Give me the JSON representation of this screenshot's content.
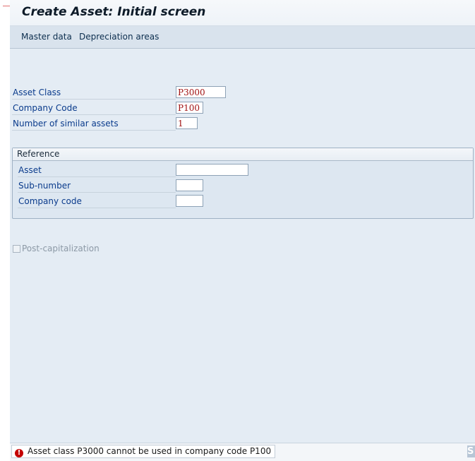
{
  "title": "Create Asset:  Initial screen",
  "toolbar": {
    "master_data": "Master data",
    "depreciation_areas": "Depreciation areas"
  },
  "form": {
    "asset_class_label": "Asset Class",
    "asset_class_value": "P3000",
    "company_code_label": "Company Code",
    "company_code_value": "P100",
    "similar_assets_label": "Number of similar assets",
    "similar_assets_value": "1"
  },
  "reference": {
    "title": "Reference",
    "asset_label": "Asset",
    "asset_value": "",
    "subnumber_label": "Sub-number",
    "subnumber_value": "",
    "company_code_label": "Company code",
    "company_code_value": ""
  },
  "post_capitalization": {
    "label": "Post-capitalization",
    "checked": false,
    "enabled": false
  },
  "status": {
    "type": "error",
    "icon": "error-icon",
    "icon_glyph": "!",
    "message": "Asset class P3000 cannot be used in company code P100"
  },
  "corner_glyph": "S",
  "colors": {
    "label": "#0a3b8c",
    "field_value": "#a01010",
    "error": "#c40000",
    "background": "#e4ecf4"
  }
}
